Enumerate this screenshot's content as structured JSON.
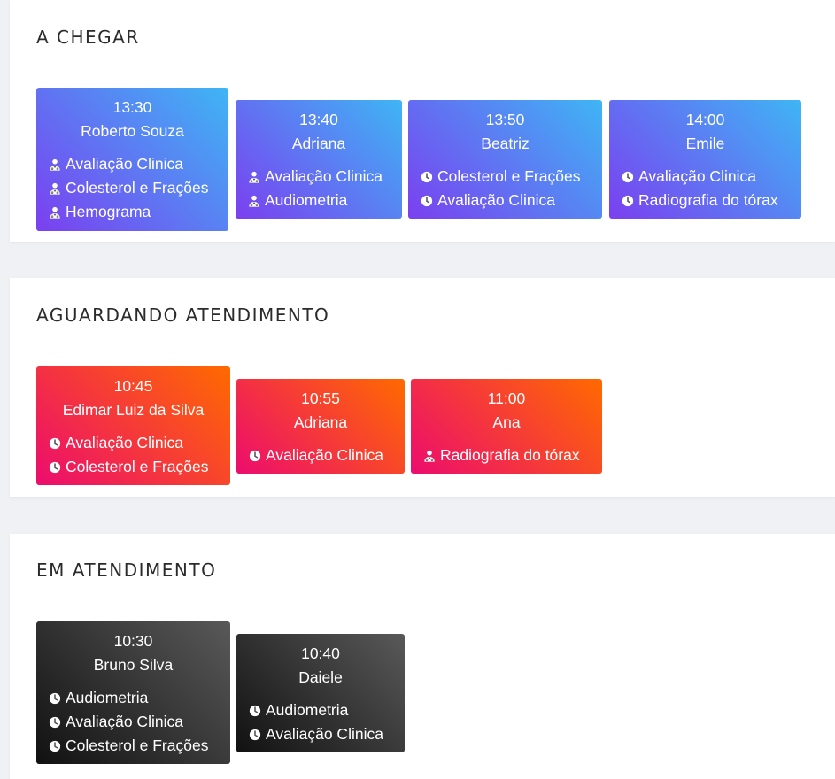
{
  "sections": [
    {
      "title": "A CHEGAR",
      "cards": [
        {
          "time": "13:30",
          "name": "Roberto Souza",
          "exams": [
            {
              "label": "Avaliação Clinica",
              "icon": "user-md-icon"
            },
            {
              "label": "Colesterol e Frações",
              "icon": "user-md-icon"
            },
            {
              "label": "Hemograma",
              "icon": "user-md-icon"
            }
          ]
        },
        {
          "time": "13:40",
          "name": "Adriana",
          "exams": [
            {
              "label": "Avaliação Clinica",
              "icon": "user-md-icon"
            },
            {
              "label": "Audiometria",
              "icon": "user-md-icon"
            }
          ]
        },
        {
          "time": "13:50",
          "name": "Beatriz",
          "exams": [
            {
              "label": "Colesterol e Frações",
              "icon": "clock-icon"
            },
            {
              "label": "Avaliação Clinica",
              "icon": "clock-icon"
            }
          ]
        },
        {
          "time": "14:00",
          "name": "Emile",
          "exams": [
            {
              "label": "Avaliação Clinica",
              "icon": "clock-icon"
            },
            {
              "label": "Radiografia do tórax",
              "icon": "clock-icon"
            }
          ]
        }
      ]
    },
    {
      "title": "AGUARDANDO ATENDIMENTO",
      "cards": [
        {
          "time": "10:45",
          "name": "Edimar Luiz da Silva",
          "exams": [
            {
              "label": "Avaliação Clinica",
              "icon": "clock-icon"
            },
            {
              "label": "Colesterol e Frações",
              "icon": "clock-icon"
            }
          ]
        },
        {
          "time": "10:55",
          "name": "Adriana",
          "exams": [
            {
              "label": "Avaliação Clinica",
              "icon": "clock-icon"
            }
          ]
        },
        {
          "time": "11:00",
          "name": "Ana",
          "exams": [
            {
              "label": "Radiografia do tórax",
              "icon": "user-md-icon"
            }
          ]
        }
      ]
    },
    {
      "title": "EM ATENDIMENTO",
      "cards": [
        {
          "time": "10:30",
          "name": "Bruno Silva",
          "exams": [
            {
              "label": "Audiometria",
              "icon": "clock-icon"
            },
            {
              "label": "Avaliação Clinica",
              "icon": "clock-icon"
            },
            {
              "label": "Colesterol e Frações",
              "icon": "clock-icon"
            }
          ]
        },
        {
          "time": "10:40",
          "name": "Daiele",
          "exams": [
            {
              "label": "Audiometria",
              "icon": "clock-icon"
            },
            {
              "label": "Avaliação Clinica",
              "icon": "clock-icon"
            }
          ]
        }
      ]
    }
  ]
}
